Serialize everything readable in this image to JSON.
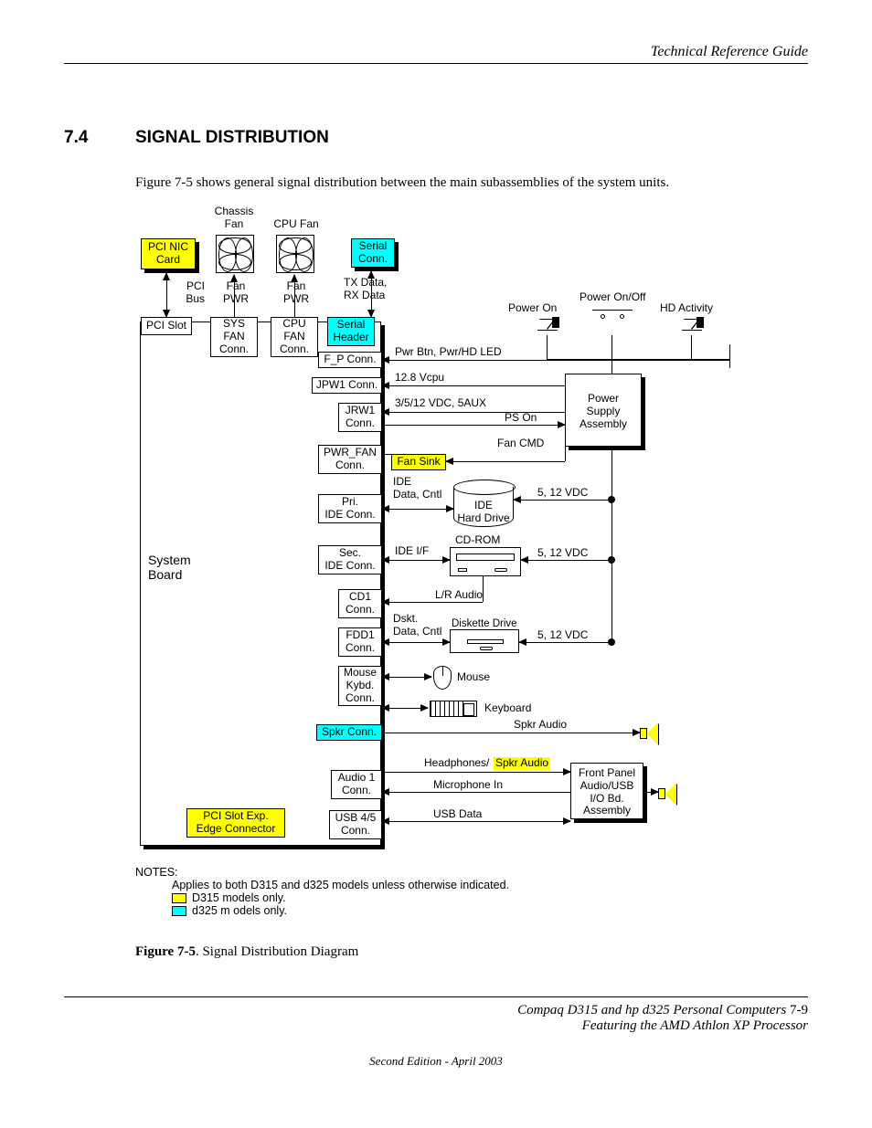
{
  "header": {
    "title": "Technical Reference Guide"
  },
  "section": {
    "number": "7.4",
    "title": "SIGNAL DISTRIBUTION"
  },
  "intro": "Figure 7-5 shows general signal distribution between the main subassemblies of the system units.",
  "diagram": {
    "top_labels": {
      "chassis_fan": "Chassis\nFan",
      "cpu_fan": "CPU Fan",
      "pci_bus": "PCI\nBus",
      "fan_pwr1": "Fan\nPWR",
      "fan_pwr2": "Fan\nPWR",
      "tx_rx": "TX Data,\nRX Data",
      "power_on": "Power On",
      "power_onoff": "Power On/Off",
      "hd_activity": "HD Activity"
    },
    "boxes": {
      "pci_nic": "PCI NIC\nCard",
      "serial_conn": "Serial\nConn.",
      "pci_slot": "PCI Slot",
      "sys_fan_conn": "SYS\nFAN\nConn.",
      "cpu_fan_conn": "CPU\nFAN\nConn.",
      "serial_header": "Serial\nHeader",
      "fp_conn": "F_P Conn.",
      "jpw1": "JPW1 Conn.",
      "jrw1": "JRW1\nConn.",
      "pwr_fan": "PWR_FAN\nConn.",
      "pri_ide": "Pri.\nIDE Conn.",
      "sec_ide": "Sec.\nIDE Conn.",
      "cd1": "CD1\nConn.",
      "fdd1": "FDD1\nConn.",
      "mouse_kbd": "Mouse\nKybd.\nConn.",
      "spkr_conn": "Spkr Conn.",
      "audio1": "Audio 1\nConn.",
      "pci_edge": "PCI Slot Exp.\nEdge Connector",
      "usb45": "USB 4/5\nConn.",
      "fan_sink": "Fan Sink",
      "ide_hd": "IDE\nHard Drive",
      "cdrom": "CD-ROM",
      "diskette": "Diskette Drive",
      "psu": "Power\nSupply\nAssembly",
      "fpanel": "Front Panel\nAudio/USB\nI/O Bd.\nAssembly",
      "mouse": "Mouse",
      "keyboard": "Keyboard",
      "system_board": "System\nBoard"
    },
    "signals": {
      "pwr_btn": "Pwr Btn, Pwr/HD LED",
      "vcpu": "12.8 Vcpu",
      "vdc_aux": "3/5/12 VDC, 5AUX",
      "ps_on": "PS On",
      "fan_cmd": "Fan CMD",
      "ide_data": "IDE\nData, Cntl",
      "v512_1": "5, 12 VDC",
      "ide_if": "IDE I/F",
      "v512_2": "5, 12 VDC",
      "lr_audio": "L/R Audio",
      "dskt": "Dskt.\nData, Cntl",
      "v512_3": "5, 12 VDC",
      "spkr_audio": "Spkr Audio",
      "headphones": "Headphones/",
      "spkr_audio2": "Spkr Audio",
      "mic_in": "Microphone In",
      "usb_data": "USB Data"
    }
  },
  "notes": {
    "heading": "NOTES:",
    "line1": "Applies to both D315 and d325 models unless otherwise indicated.",
    "d315": "D315 models only.",
    "d325": "d325 m odels only."
  },
  "caption": {
    "ref": "Figure 7-5",
    "text": ".   Signal Distribution Diagram"
  },
  "footer": {
    "line1a": "Compaq D315 and hp d325 Personal Computers",
    "page": "  7-9",
    "line2": "Featuring the AMD Athlon XP Processor",
    "edition": "Second Edition - April 2003"
  }
}
